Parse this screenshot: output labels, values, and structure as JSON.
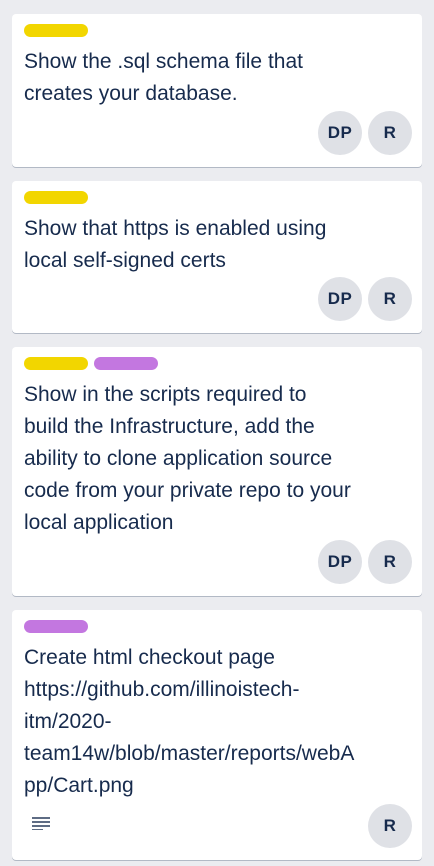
{
  "colors": {
    "label_yellow": "#f2d600",
    "label_purple": "#c377e0",
    "avatar_bg": "#dfe1e6",
    "text": "#172b4d",
    "board_bg": "#ebecf0"
  },
  "cards": [
    {
      "labels": [
        "yellow"
      ],
      "title": "Show the .sql schema file that\ncreates your database.",
      "members": [
        "DP",
        "R"
      ],
      "has_description": false
    },
    {
      "labels": [
        "yellow"
      ],
      "title": "Show that https is enabled using\nlocal self-signed certs",
      "members": [
        "DP",
        "R"
      ],
      "has_description": false
    },
    {
      "labels": [
        "yellow",
        "purple"
      ],
      "title": "Show in the scripts required to\nbuild the Infrastructure, add the\nability to clone application source\ncode from your private repo to your\nlocal application",
      "members": [
        "DP",
        "R"
      ],
      "has_description": false
    },
    {
      "labels": [
        "purple"
      ],
      "title": "Create html checkout page\nhttps://github.com/illinoistech-\nitm/2020-\nteam14w/blob/master/reports/webA\npp/Cart.png",
      "members": [
        "R"
      ],
      "has_description": true,
      "description_icon": "description-lines-icon"
    }
  ]
}
